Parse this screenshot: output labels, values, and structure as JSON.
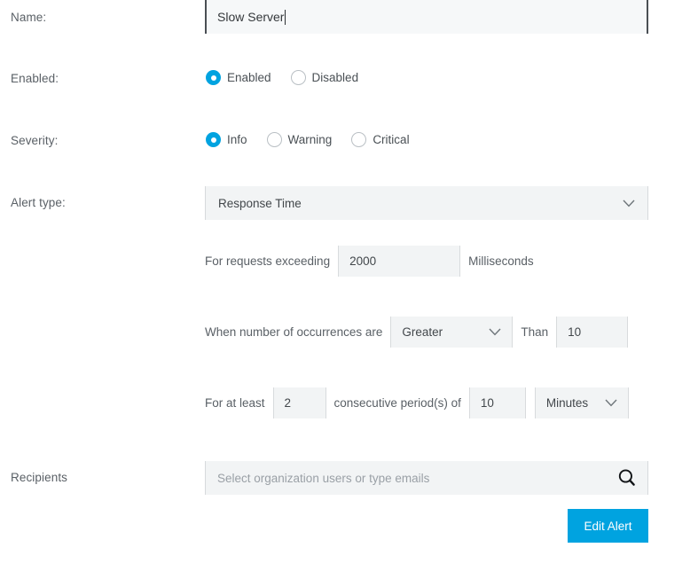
{
  "form": {
    "fields": {
      "name": {
        "label": "Name:",
        "value": "Slow Server",
        "placeholder": ""
      },
      "enabled": {
        "label": "Enabled:",
        "options": [
          {
            "label": "Enabled",
            "selected": true
          },
          {
            "label": "Disabled",
            "selected": false
          }
        ]
      },
      "severity": {
        "label": "Severity:",
        "options": [
          {
            "label": "Info",
            "selected": true
          },
          {
            "label": "Warning",
            "selected": false
          },
          {
            "label": "Critical",
            "selected": false
          }
        ]
      },
      "alert_type": {
        "label": "Alert type:",
        "value": "Response Time",
        "chevron_icon": "chevron-down-icon"
      },
      "threshold": {
        "prefix_text": "For requests exceeding",
        "value": "2000",
        "suffix_text": "Milliseconds"
      },
      "occurrences": {
        "prefix_text": "When number of occurrences are",
        "operator": "Greater",
        "operator_chevron_icon": "chevron-down-icon",
        "middle_text": "Than",
        "value": "10"
      },
      "duration": {
        "prefix_text": "For at least",
        "periods": "2",
        "middle_text": "consecutive period(s) of",
        "interval_value": "10",
        "interval_unit": "Minutes",
        "unit_chevron_icon": "chevron-down-icon"
      },
      "recipients": {
        "label": "Recipients",
        "value": "",
        "placeholder": "Select organization users or type emails",
        "search_icon": "search-icon"
      }
    },
    "actions": {
      "submit_label": "Edit Alert"
    },
    "colors": {
      "accent": "#00a3e0",
      "field_background": "#f2f4f5",
      "focused_field_border": "#4a4f54",
      "label_text": "#5a6066",
      "placeholder_text": "#9aa0a6"
    }
  }
}
